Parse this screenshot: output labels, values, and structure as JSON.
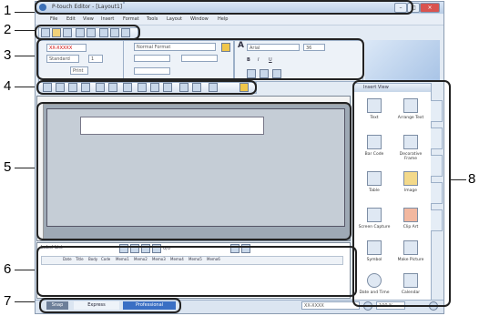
{
  "callouts": [
    "1",
    "2",
    "3",
    "4",
    "5",
    "6",
    "7",
    "8"
  ],
  "window": {
    "title": "P-touch Editor - [Layout1]",
    "min": "–",
    "max": "□",
    "close": "×"
  },
  "menu": [
    "File",
    "Edit",
    "View",
    "Insert",
    "Format",
    "Tools",
    "Layout",
    "Window",
    "Help"
  ],
  "property": {
    "page_field": "XX-XXXXX",
    "paper_field": "Standard",
    "length": "1",
    "print_label": "Print",
    "text_label": "A",
    "font": "Arial",
    "size": "36",
    "format_label": "Normal Format"
  },
  "layout_tabs": [
    "Label List"
  ],
  "table": {
    "counter": "0/0",
    "columns": [
      "Date",
      "Title",
      "Body",
      "Code",
      "Memo1",
      "Memo2",
      "Memo3",
      "Memo4",
      "Memo5",
      "Memo6"
    ]
  },
  "sidebar": {
    "title": "Insert View",
    "items": [
      "Text",
      "Arrange Text",
      "Bar Code",
      "Decorative Frame",
      "Table",
      "Image",
      "Screen Capture",
      "Clip Art",
      "Symbol",
      "Make Picture",
      "Date and Time",
      "Calendar"
    ]
  },
  "status": {
    "tabs": [
      "Snap",
      "Express",
      "Professional"
    ],
    "printer": "XX-XXXX",
    "zoom": "100 %"
  }
}
